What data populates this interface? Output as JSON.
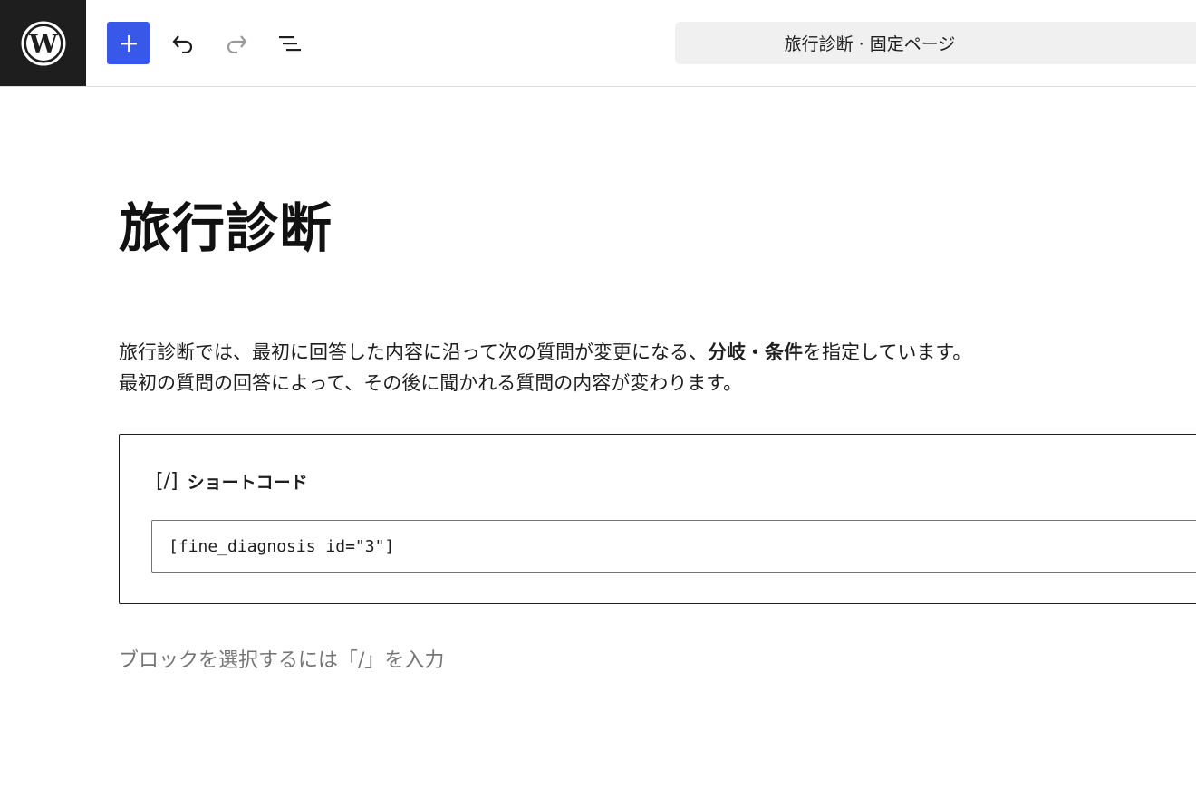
{
  "toolbar": {
    "logo_name": "wordpress-logo",
    "add_icon": "plus-icon",
    "undo_icon": "undo-icon",
    "redo_icon": "redo-icon",
    "list_view_icon": "list-view-icon",
    "document_title": "旅行診断 · 固定ページ",
    "accent_color": "#3858e9"
  },
  "content": {
    "heading": "旅行診断",
    "intro_line1_pre": "旅行診断では、最初に回答した内容に沿って次の質問が変更になる、",
    "intro_line1_bold": "分岐・条件",
    "intro_line1_post": "を指定しています。",
    "intro_line2": "最初の質問の回答によって、その後に聞かれる質問の内容が変わります。",
    "shortcode_block": {
      "icon": "[/]",
      "label": "ショートコード",
      "value": "[fine_diagnosis id=\"3\"]"
    },
    "appender_placeholder": "ブロックを選択するには「/」を入力"
  }
}
